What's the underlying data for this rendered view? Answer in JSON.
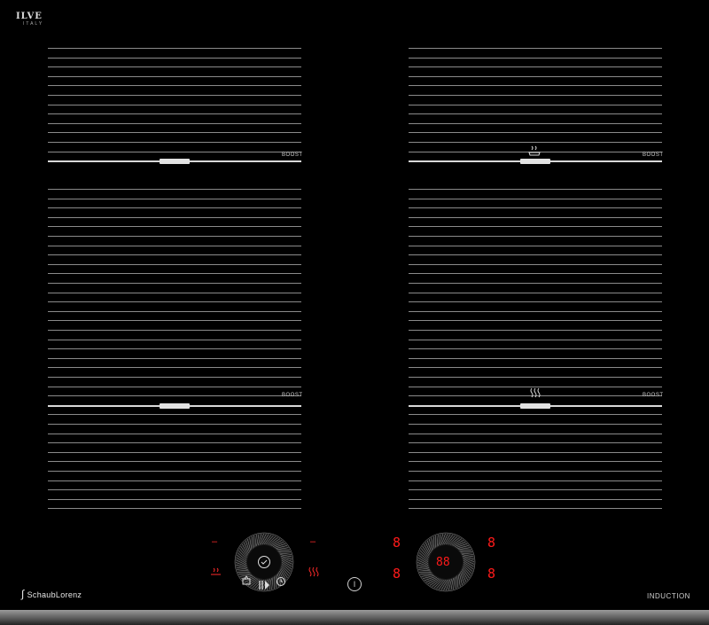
{
  "brand_top": {
    "mark": "ILVE",
    "sub": "ITALY"
  },
  "zones": [
    {
      "id": "rear-left",
      "boost_label": "BOOST",
      "icon": ""
    },
    {
      "id": "rear-right",
      "boost_label": "BOOST",
      "icon": "pan-steam-icon"
    },
    {
      "id": "front-left",
      "boost_label": "BOOST",
      "icon": ""
    },
    {
      "id": "front-right",
      "boost_label": "BOOST",
      "icon": "heat-waves-icon"
    }
  ],
  "controls": {
    "left_top_left": "–",
    "left_top_right": "–",
    "right_digit_tl": "8",
    "right_digit_tr": "8",
    "right_digit_bl": "8",
    "right_digit_br": "8",
    "timer_display": "88",
    "power_symbol": "I"
  },
  "footer": {
    "brand": "SchaubLorenz",
    "label": "INDUCTION"
  }
}
